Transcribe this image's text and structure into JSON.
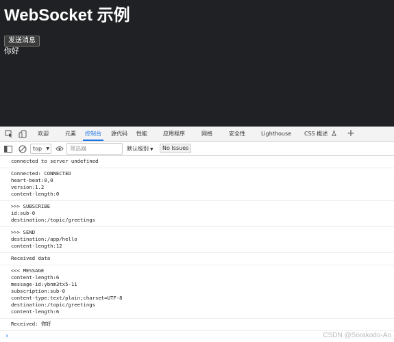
{
  "page": {
    "title": "WebSocket 示例",
    "button_label": "发送消息",
    "message": "你好"
  },
  "devtools": {
    "icons": [
      "inspect-icon",
      "device-toggle-icon"
    ],
    "tabs": [
      {
        "label": "欢迎",
        "active": false
      },
      {
        "label": "元素",
        "active": false
      },
      {
        "label": "控制台",
        "active": true
      },
      {
        "label": "源代码",
        "active": false
      },
      {
        "label": "性能",
        "active": false
      },
      {
        "label": "应用程序",
        "active": false
      },
      {
        "label": "网络",
        "active": false
      },
      {
        "label": "安全性",
        "active": false
      },
      {
        "label": "Lighthouse",
        "active": false
      },
      {
        "label": "CSS 概述",
        "active": false
      }
    ],
    "accent_color": "#1a73e8"
  },
  "toolbar": {
    "context": "top",
    "filter_placeholder": "筛选器",
    "level": "默认级别",
    "issues": "No Issues"
  },
  "console": {
    "entries": [
      {
        "lines": [
          "connected to server undefined"
        ]
      },
      {
        "lines": [
          "Connected: CONNECTED",
          "heart-beat:0,0",
          "version:1.2",
          "content-length:0"
        ]
      },
      {
        "lines": [
          ">>> SUBSCRIBE",
          "id:sub-0",
          "destination:/topic/greetings"
        ]
      },
      {
        "lines": [
          ">>> SEND",
          "destination:/app/hello",
          "content-length:12"
        ]
      },
      {
        "lines": [
          "Received data"
        ]
      },
      {
        "lines": [
          "<<< MESSAGE",
          "content-length:6",
          "message-id:ybnm3tx5-11",
          "subscription:sub-0",
          "content-type:text/plain;charset=UTF-8",
          "destination:/topic/greetings",
          "content-length:6"
        ]
      },
      {
        "lines": [
          "Received: 你好"
        ]
      }
    ],
    "prompt": "›"
  },
  "watermark": "CSDN @Sorakodo-Ao"
}
